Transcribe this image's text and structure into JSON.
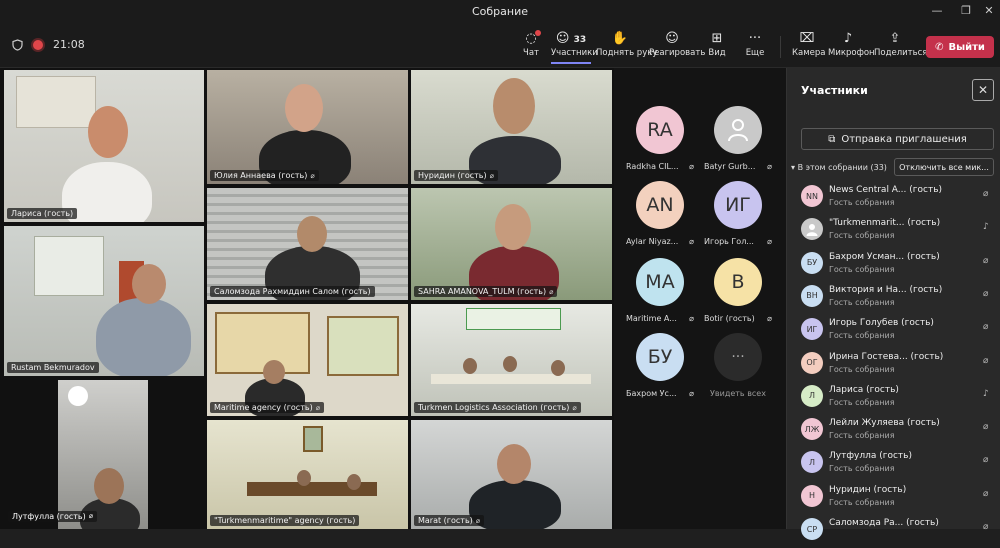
{
  "window": {
    "title": "Собрание",
    "minimize": "—",
    "restore": "❐",
    "close": "✕"
  },
  "status": {
    "time": "21:08",
    "shield": "shield-icon",
    "recording": "recording-dot"
  },
  "toolbar": {
    "chat": "Чат",
    "participants": "Участники",
    "participants_count": "33",
    "raise_hand": "Поднять руку",
    "react": "Реагировать",
    "view": "Вид",
    "more": "Еще",
    "camera": "Камера",
    "mic": "Микрофон",
    "share": "Поделиться",
    "leave": "Выйти",
    "icons": {
      "chat": "◌",
      "people": "☺",
      "hand": "✋",
      "smile": "☺",
      "view": "⊞",
      "more": "···",
      "camera": "⌧",
      "mic": "♪",
      "share": "⇪",
      "phone": "✆"
    }
  },
  "tiles": [
    {
      "name": "Лариса (гость)"
    },
    {
      "name": "Юлия Аннаева (гость)"
    },
    {
      "name": "Нуридин (гость)"
    },
    {
      "name": "Rustam Bekmuradov"
    },
    {
      "name": "Саломзода Рахмиддин Салом (гость)"
    },
    {
      "name": "SAHRA AMANOVA_TULM (гость)"
    },
    {
      "name": "Maritime agency (гость)"
    },
    {
      "name": "Turkmen Logistics Association (гость)"
    },
    {
      "name": "Лутфулла (гость)"
    },
    {
      "name": "\"Turkmenmaritime\" agency (гость)"
    },
    {
      "name": "Marat (гость)"
    }
  ],
  "avatars": [
    {
      "initials": "RA",
      "name": "Radkha CIL...",
      "color": "#f1c6d3"
    },
    {
      "initials": "",
      "name": "Batyr Gurb...",
      "color": "#c9c9c9"
    },
    {
      "initials": "AN",
      "name": "Aylar Niyaz...",
      "color": "#f3d1be"
    },
    {
      "initials": "ИГ",
      "name": "Игорь Гол...",
      "color": "#c8c4ef"
    },
    {
      "initials": "MA",
      "name": "Maritime A...",
      "color": "#bfe3ef"
    },
    {
      "initials": "B",
      "name": "Botir (гость)",
      "color": "#f6e2a6"
    },
    {
      "initials": "БУ",
      "name": "Бахром Ус...",
      "color": "#c9def2"
    },
    {
      "initials": "···",
      "name": "Увидеть всех",
      "color": "#2b2b2b"
    }
  ],
  "panel": {
    "title": "Участники",
    "invite": "Отправка приглашения",
    "section": "В этом собрании (33)",
    "mute_all": "Отключить все мик...",
    "people": [
      {
        "initials": "NN",
        "name": "News Central A... (гость)",
        "role": "Гость собрания",
        "color": "#f1c6d3",
        "mic": "off"
      },
      {
        "initials": "",
        "name": "\"Turkmenmarit... (гость)",
        "role": "Гость собрания",
        "color": "#c9c9c9",
        "mic": "on"
      },
      {
        "initials": "БУ",
        "name": "Бахром Усман... (гость)",
        "role": "Гость собрания",
        "color": "#c9def2",
        "mic": "off"
      },
      {
        "initials": "ВН",
        "name": "Виктория и На... (гость)",
        "role": "Гость собрания",
        "color": "#c9def2",
        "mic": "off"
      },
      {
        "initials": "ИГ",
        "name": "Игорь Голубев (гость)",
        "role": "Гость собрания",
        "color": "#c8c4ef",
        "mic": "off"
      },
      {
        "initials": "ОГ",
        "name": "Ирина Гостева... (гость)",
        "role": "Гость собрания",
        "color": "#f3cdbf",
        "mic": "off"
      },
      {
        "initials": "Л",
        "name": "Лариса (гость)",
        "role": "Гость собрания",
        "color": "#d6ecc7",
        "mic": "on"
      },
      {
        "initials": "ЛЖ",
        "name": "Лейли Жуляева (гость)",
        "role": "Гость собрания",
        "color": "#f1c6d3",
        "mic": "off"
      },
      {
        "initials": "Л",
        "name": "Лутфулла (гость)",
        "role": "Гость собрания",
        "color": "#c8c4ef",
        "mic": "off"
      },
      {
        "initials": "Н",
        "name": "Нуридин (гость)",
        "role": "Гость собрания",
        "color": "#f1c6d3",
        "mic": "off"
      },
      {
        "initials": "СР",
        "name": "Саломзода Ра... (гость)",
        "role": "",
        "color": "#c9def2",
        "mic": "off"
      }
    ]
  }
}
